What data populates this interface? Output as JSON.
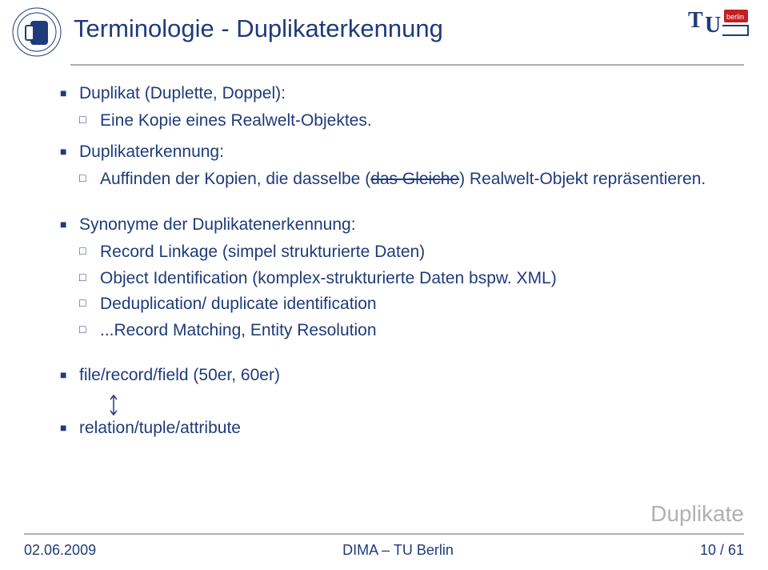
{
  "title": "Terminologie - Duplikaterkennung",
  "bullets": {
    "b1": "Duplikat (Duplette, Doppel):",
    "b1_1": "Eine Kopie eines Realwelt-Objektes.",
    "b2": "Duplikaterkennung:",
    "b2_1_pre": "Auffinden der Kopien, die dasselbe (",
    "b2_1_strike": "das Gleiche",
    "b2_1_post": ") Realwelt-Objekt repräsentieren.",
    "b3": "Synonyme der Duplikatenerkennung:",
    "b3_1": "Record Linkage (simpel strukturierte Daten)",
    "b3_2": "Object Identification (komplex-strukturierte Daten bspw. XML)",
    "b3_3": "Deduplication/ duplicate identification",
    "b3_4": "...Record Matching, Entity Resolution",
    "b4": "file/record/field  (50er, 60er)",
    "b5": "relation/tuple/attribute"
  },
  "category": "Duplikate",
  "footer": {
    "date": "02.06.2009",
    "center": "DIMA – TU Berlin",
    "page": "10 / 61"
  }
}
